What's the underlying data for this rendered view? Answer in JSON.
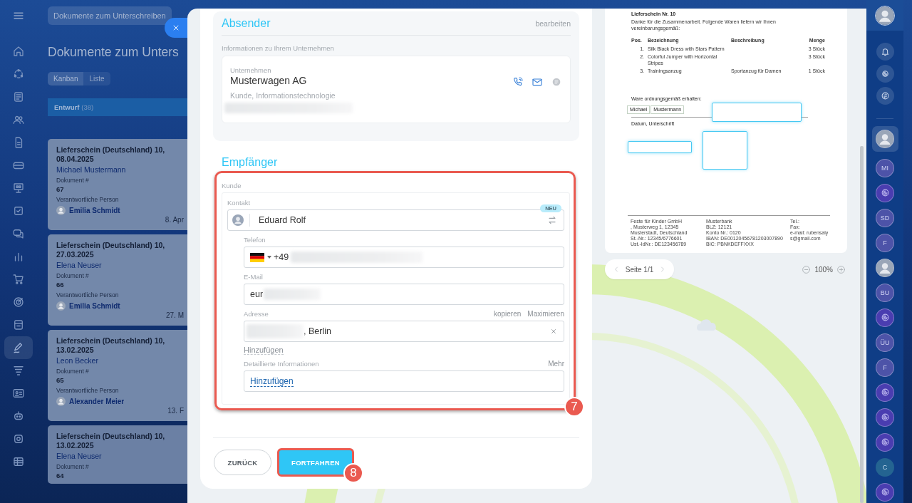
{
  "left_nav": {
    "items": [
      {
        "selected": false
      },
      {
        "selected": false
      },
      {
        "selected": false
      },
      {
        "selected": false
      },
      {
        "selected": false
      },
      {
        "selected": false
      },
      {
        "selected": false
      },
      {
        "selected": false
      },
      {
        "selected": false
      },
      {
        "selected": false
      },
      {
        "selected": false
      },
      {
        "selected": false
      },
      {
        "selected": false
      },
      {
        "selected": true
      },
      {
        "selected": false
      },
      {
        "selected": false
      },
      {
        "selected": false
      },
      {
        "selected": false
      },
      {
        "selected": false
      }
    ]
  },
  "header": {
    "title_pill": "Dokumente zum Unterschreiben"
  },
  "page_title": "Dokumente zum Unters",
  "view_tabs": [
    {
      "label": "Kanban",
      "selected": true
    },
    {
      "label": "Liste",
      "selected": false
    }
  ],
  "kanban": {
    "column": {
      "name": "Entwurf",
      "count": "(38)"
    },
    "cards": [
      {
        "title": "Lieferschein (Deutschland) 10, 08.04.2025",
        "client": "Michael Mustermann",
        "doc_label": "Dokument #",
        "doc_number": "67",
        "person_label": "Verantwortliche Person",
        "person": "Emilia Schmidt",
        "date": "8. Apr"
      },
      {
        "title": "Lieferschein (Deutschland) 10, 27.03.2025",
        "client": "Elena Neuser",
        "doc_label": "Dokument #",
        "doc_number": "66",
        "person_label": "Verantwortliche Person",
        "person": "Emilia Schmidt",
        "date": "27. M"
      },
      {
        "title": "Lieferschein (Deutschland) 10, 13.02.2025",
        "client": "Leon Becker",
        "doc_label": "Dokument #",
        "doc_number": "65",
        "person_label": "Verantwortliche Person",
        "person": "Alexander Meier",
        "date": "13. F"
      },
      {
        "title": "Lieferschein (Deutschland) 10, 13.02.2025",
        "client": "Elena Neuser",
        "doc_label": "Dokument #",
        "doc_number": "64"
      }
    ]
  },
  "sender": {
    "heading": "Absender",
    "edit": "bearbeiten",
    "subtitle": "Informationen zu Ihrem Unternehmen",
    "company_label": "Unternehmen",
    "company": "Musterwagen AG",
    "company_info": "Kunde, Informationstechnologie"
  },
  "recipient": {
    "heading": "Empfänger",
    "client_label": "Kunde",
    "contact_label": "Kontakt",
    "contact_name": "Eduard Rolf",
    "badge": "NEU",
    "phone_label": "Telefon",
    "phone_code": "+49",
    "email_label": "E-Mail",
    "email_value": "eur",
    "address_label": "Adresse",
    "address_actions": [
      "kopieren",
      "Maximieren"
    ],
    "address_value": ", Berlin",
    "add_link": "Hinzufügen",
    "details_label": "Detaillierte Informationen",
    "details_more": "Mehr",
    "details_link": "Hinzufügen"
  },
  "callouts": [
    "7",
    "8"
  ],
  "buttons": [
    {
      "label": "ZURÜCK",
      "kind": "secondary"
    },
    {
      "label": "FORTFAHREN",
      "kind": "primary"
    }
  ],
  "preview": {
    "title": "Lieferschein Nr. 10",
    "intro": "Danke für die Zusammenarbeit. Folgende Waren liefern wir Ihnen vereinbarungsgemäß:",
    "columns": [
      "Pos.",
      "Bezeichnung",
      "Beschreibung",
      "Menge"
    ],
    "rows": [
      [
        "1.",
        "Silk Black Dress with Stars Pattern",
        "",
        "3 Stück"
      ],
      [
        "2.",
        "Colorful Jumper with Horizontal Stripes",
        "",
        "3 Stück"
      ],
      [
        "3.",
        "Trainingsanzug",
        "Sportanzug für Damen",
        "1 Stück"
      ]
    ],
    "received": "Ware ordnungsgemäß erhalten:",
    "first_name": "Michael",
    "last_name": "Mustermann",
    "date_signature": "Datum, Unterschrift",
    "footer": [
      [
        "Feste für Kinder GmbH",
        ", Musterweg 1, 12345 Musterstadt, Deutschland",
        "St.-Nr.: 12345/6776601",
        "Ust.-IdNr.: DE123456789"
      ],
      [
        "Musterbank",
        "BLZ: 12121",
        "Konto Nr.: 0120",
        "IBAN: DE00120456781203007890",
        "BIC: PBNKDEFFXXX"
      ],
      [
        "Tel.:",
        "Fax:",
        "e-mail: rubensalys@gmail.com"
      ]
    ],
    "pager": "Seite 1/1",
    "zoom": "100%"
  },
  "right_bar": {
    "contacts": [
      {
        "kind": "photo",
        "selected": true
      },
      {
        "kind": "initials",
        "label": "MI",
        "selected": false
      },
      {
        "kind": "logo",
        "selected": false
      },
      {
        "kind": "initials",
        "label": "SD",
        "selected": false
      },
      {
        "kind": "initials",
        "label": "F",
        "selected": false
      },
      {
        "kind": "photo",
        "selected": false
      },
      {
        "kind": "initials",
        "label": "BU",
        "selected": false
      },
      {
        "kind": "logo",
        "selected": false
      },
      {
        "kind": "initials",
        "label": "ÜU",
        "selected": false
      },
      {
        "kind": "initials",
        "label": "F",
        "selected": false
      },
      {
        "kind": "logo",
        "selected": false
      },
      {
        "kind": "logo",
        "selected": false
      },
      {
        "kind": "logo",
        "selected": false
      },
      {
        "kind": "team",
        "label": "C",
        "selected": false
      },
      {
        "kind": "logo",
        "selected": false
      }
    ]
  }
}
